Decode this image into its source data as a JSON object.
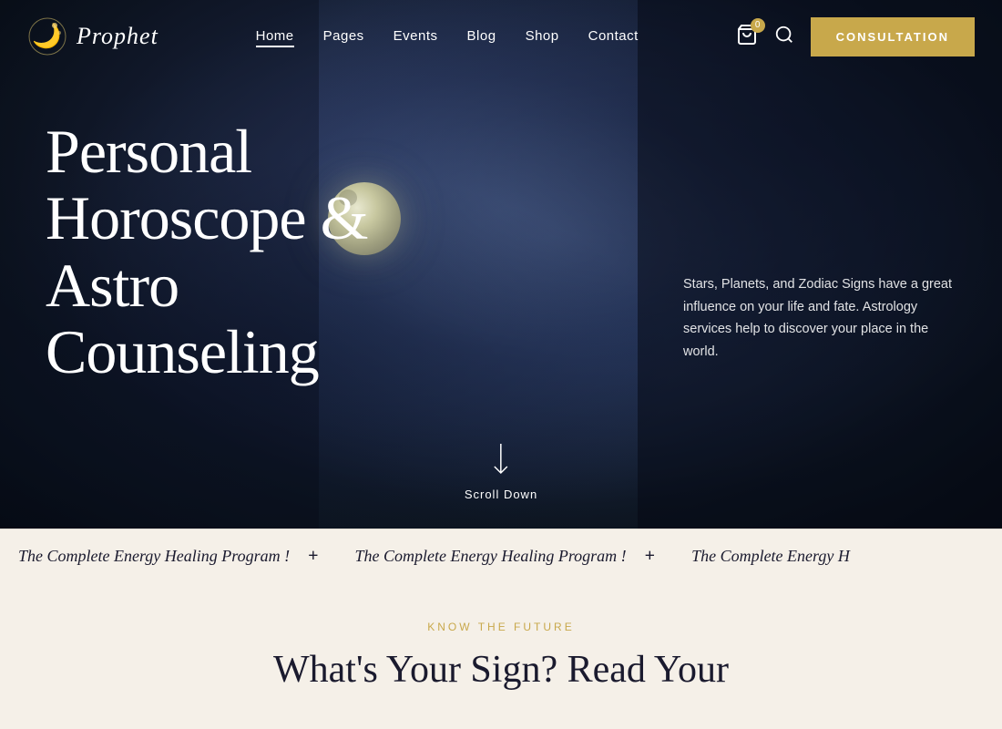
{
  "brand": {
    "logo_text": "Prophet",
    "logo_icon": "moon-star-icon"
  },
  "navbar": {
    "links": [
      {
        "label": "Home",
        "active": true
      },
      {
        "label": "Pages",
        "active": false
      },
      {
        "label": "Events",
        "active": false
      },
      {
        "label": "Blog",
        "active": false
      },
      {
        "label": "Shop",
        "active": false
      },
      {
        "label": "Contact",
        "active": false
      }
    ],
    "cart_count": "0",
    "consultation_label": "CONSULTATION"
  },
  "hero": {
    "headline_line1": "Personal",
    "headline_line2": "Horoscope &",
    "headline_line3": "Astro",
    "headline_line4": "Counseling",
    "description": "Stars, Planets, and Zodiac Signs have a great influence on your life and fate. Astrology services help to discover your place in the world.",
    "scroll_down_label": "Scroll Down"
  },
  "ticker": {
    "items": [
      {
        "text": "The Complete Energy Healing Program !",
        "separator": "+"
      },
      {
        "text": "The Complete Energy Healing Program !",
        "separator": "+"
      },
      {
        "text": "The Complete Energy H",
        "separator": ""
      }
    ]
  },
  "bottom_section": {
    "label": "KNOW THE FUTURE",
    "headline": "What's Your Sign? Read Your"
  },
  "icons": {
    "cart": "🛒",
    "search": "🔍",
    "scroll_arrow": "↓",
    "moon_star": "🌙"
  }
}
